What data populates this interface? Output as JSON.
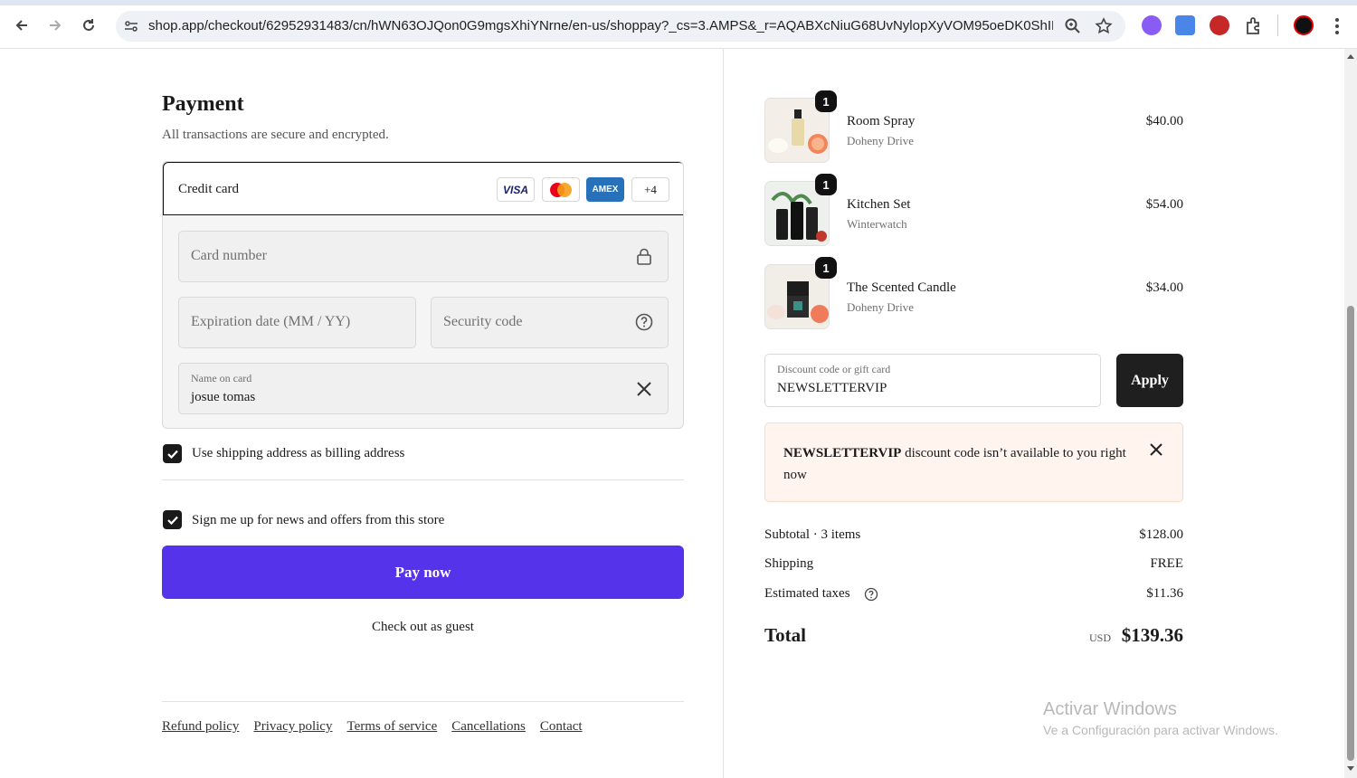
{
  "browser": {
    "url": "shop.app/checkout/62952931483/cn/hWN63OJQon0G9mgsXhiYNrne/en-us/shoppay?_cs=3.AMPS&_r=AQABXcNiuG68UvNylopXyVOM95oeDK0ShIFf5IQ..."
  },
  "payment": {
    "title": "Payment",
    "subtitle": "All transactions are secure and encrypted.",
    "method_label": "Credit card",
    "card_brands": [
      "VISA",
      "Mastercard",
      "AMEX"
    ],
    "more_brands": "+4",
    "card_number_placeholder": "Card number",
    "expiration_placeholder": "Expiration date (MM / YY)",
    "security_placeholder": "Security code",
    "name_label": "Name on card",
    "name_value": "josue tomas",
    "billing_checkbox_label": "Use shipping address as billing address",
    "news_checkbox_label": "Sign me up for news and offers from this store",
    "pay_button": "Pay now",
    "guest_link": "Check out as guest"
  },
  "footer": {
    "links": [
      "Refund policy",
      "Privacy policy",
      "Terms of service",
      "Cancellations",
      "Contact"
    ]
  },
  "order": {
    "items": [
      {
        "qty": "1",
        "name": "Room Spray",
        "vendor": "Doheny Drive",
        "price": "$40.00"
      },
      {
        "qty": "1",
        "name": "Kitchen Set",
        "vendor": "Winterwatch",
        "price": "$54.00"
      },
      {
        "qty": "1",
        "name": "The Scented Candle",
        "vendor": "Doheny Drive",
        "price": "$34.00"
      }
    ],
    "discount_label": "Discount code or gift card",
    "discount_value": "NEWSLETTERVIP",
    "apply_button": "Apply",
    "error_code": "NEWSLETTERVIP",
    "error_message": " discount code isn’t available to you right now",
    "subtotal_label": "Subtotal · 3 items",
    "subtotal_value": "$128.00",
    "shipping_label": "Shipping",
    "shipping_value": "FREE",
    "taxes_label": "Estimated taxes",
    "taxes_value": "$11.36",
    "total_label": "Total",
    "total_currency": "USD",
    "total_value": "$139.36"
  },
  "watermark": {
    "line1": "Activar Windows",
    "line2": "Ve a Configuración para activar Windows."
  },
  "colors": {
    "pay_button": "#5433eb",
    "error_bg": "#fff4ee"
  }
}
